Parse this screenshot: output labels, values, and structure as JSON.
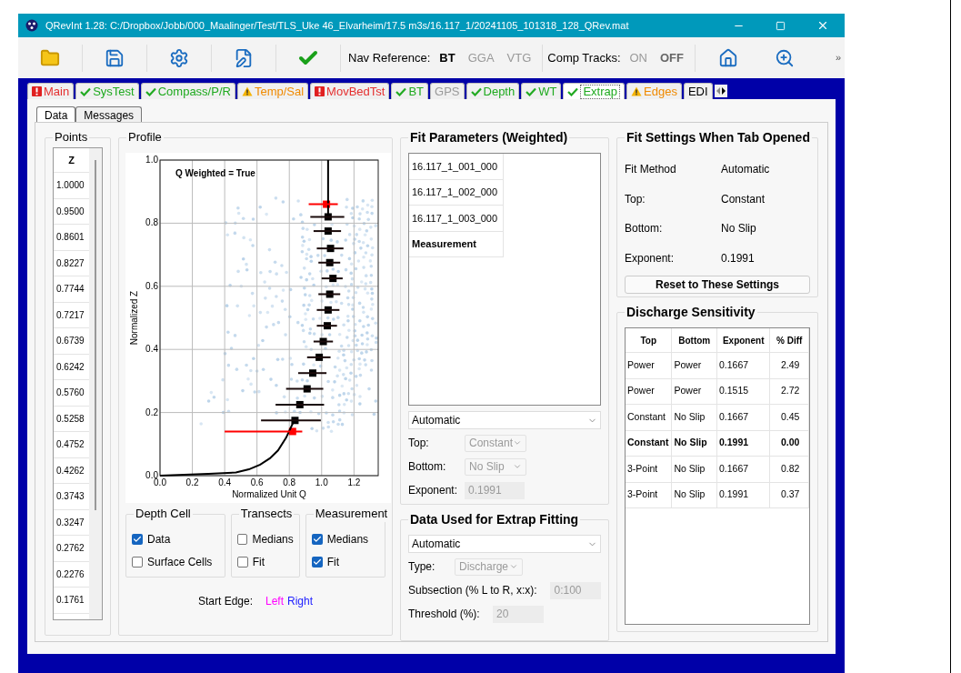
{
  "window": {
    "title": "QRevInt 1.28: C:/Dropbox/Jobb/000_Maalinger/Test/TLS_Uke 46_Elvarheim/17.5 m3s/16.117_1/20241105_101318_128_QRev.mat"
  },
  "toolbar": {
    "buttons": [
      {
        "kind": "open"
      },
      {
        "kind": "save"
      },
      {
        "kind": "settings"
      },
      {
        "kind": "edit"
      },
      {
        "kind": "check"
      }
    ],
    "nav_reference": {
      "label": "Nav Reference:",
      "options": [
        {
          "label": "BT",
          "selected": true
        },
        {
          "label": "GGA",
          "selected": false
        },
        {
          "label": "VTG",
          "selected": false
        }
      ]
    },
    "comp_tracks": {
      "label": "Comp Tracks:",
      "options": [
        {
          "label": "ON",
          "selected": false
        },
        {
          "label": "OFF",
          "selected": true
        }
      ]
    },
    "right_buttons": [
      {
        "kind": "home"
      },
      {
        "kind": "zoom"
      }
    ],
    "overflow": "»"
  },
  "tabs": [
    {
      "label": "Main",
      "kind": "error",
      "selected": false
    },
    {
      "label": "SysTest",
      "kind": "ok",
      "selected": false
    },
    {
      "label": "Compass/P/R",
      "kind": "ok",
      "selected": false
    },
    {
      "label": "Temp/Sal",
      "kind": "warning",
      "selected": false
    },
    {
      "label": "MovBedTst",
      "kind": "error",
      "selected": false
    },
    {
      "label": "BT",
      "kind": "ok",
      "selected": false
    },
    {
      "label": "GPS",
      "kind": "inactive",
      "selected": false
    },
    {
      "label": "Depth",
      "kind": "ok",
      "selected": false
    },
    {
      "label": "WT",
      "kind": "ok",
      "selected": false
    },
    {
      "label": "Extrap",
      "kind": "ok",
      "selected": true
    },
    {
      "label": "Edges",
      "kind": "warning",
      "selected": false
    },
    {
      "label": "EDI",
      "kind": "plain",
      "selected": false
    }
  ],
  "subtabs": [
    {
      "label": "Data",
      "selected": true
    },
    {
      "label": "Messages",
      "selected": false
    }
  ],
  "points": {
    "title": "Points",
    "column": "Z",
    "rows": [
      "1.0000",
      "0.9500",
      "0.8601",
      "0.8227",
      "0.7744",
      "0.7217",
      "0.6739",
      "0.6242",
      "0.5760",
      "0.5258",
      "0.4752",
      "0.4262",
      "0.3743",
      "0.3247",
      "0.2762",
      "0.2276",
      "0.1761"
    ]
  },
  "profile": {
    "title": "Profile",
    "chart_data": {
      "type": "scatter",
      "title": "Q Weighted = True",
      "xlabel": "Normalized Unit Q",
      "ylabel": "Normalized Z",
      "xlim": [
        0,
        1.35
      ],
      "ylim": [
        0,
        1
      ],
      "xticks": [
        {
          "value": 0,
          "label": "0.0"
        },
        {
          "value": 0.2,
          "label": "0.2"
        },
        {
          "value": 0.4,
          "label": "0.4"
        },
        {
          "value": 0.6,
          "label": "0.6"
        },
        {
          "value": 0.8,
          "label": "0.8"
        },
        {
          "value": 1,
          "label": "1.0"
        },
        {
          "value": 1.2,
          "label": "1.2"
        }
      ],
      "yticks": [
        {
          "value": 0,
          "label": "0.0"
        },
        {
          "value": 0.2,
          "label": "0.2"
        },
        {
          "value": 0.4,
          "label": "0.4"
        },
        {
          "value": 0.6,
          "label": "0.6"
        },
        {
          "value": 0.8,
          "label": "0.8"
        },
        {
          "value": 1,
          "label": "1.0"
        }
      ],
      "grid": true,
      "series": [
        {
          "color": "#000000",
          "type": "scatter",
          "x": [
            1.04,
            1.04,
            1.055,
            1.05,
            1.07,
            1.05,
            1.04,
            1.035,
            1.01,
            0.985,
            0.945,
            0.91,
            0.865,
            0.835
          ],
          "values": [
            0.82,
            0.775,
            0.72,
            0.675,
            0.625,
            0.575,
            0.525,
            0.475,
            0.425,
            0.375,
            0.325,
            0.275,
            0.225,
            0.175
          ]
        },
        {
          "color": "#ff0000",
          "type": "scatter",
          "x": [
            1.03,
            0.82
          ],
          "values": [
            0.86,
            0.14
          ]
        },
        {
          "color": "#000000",
          "type": "line",
          "x": [
            0,
            0.3,
            0.47,
            0.55,
            0.62,
            0.68,
            0.73,
            0.78,
            0.83,
            null,
            1.04,
            1.04
          ],
          "values": [
            0,
            0.006,
            0.01,
            0.02,
            0.035,
            0.055,
            0.08,
            0.12,
            0.175,
            null,
            0.82,
            1.0
          ]
        },
        {
          "color": "#1a0a0a",
          "type": "line",
          "x": [
            0.93,
            1.14
          ],
          "values": [
            0.82,
            0.82
          ]
        },
        {
          "color": "#1a0a0a",
          "type": "line",
          "x": [
            0.95,
            1.12
          ],
          "values": [
            0.775,
            0.775
          ]
        },
        {
          "color": "#1a0a0a",
          "type": "line",
          "x": [
            0.97,
            1.135
          ],
          "values": [
            0.72,
            0.72
          ]
        },
        {
          "color": "#1a0a0a",
          "type": "line",
          "x": [
            0.98,
            1.115
          ],
          "values": [
            0.675,
            0.675
          ]
        },
        {
          "color": "#1a0a0a",
          "type": "line",
          "x": [
            1.0,
            1.13
          ],
          "values": [
            0.625,
            0.625
          ]
        },
        {
          "color": "#1a0a0a",
          "type": "line",
          "x": [
            0.98,
            1.115
          ],
          "values": [
            0.575,
            0.575
          ]
        },
        {
          "color": "#1a0a0a",
          "type": "line",
          "x": [
            0.97,
            1.11
          ],
          "values": [
            0.525,
            0.525
          ]
        },
        {
          "color": "#1a0a0a",
          "type": "line",
          "x": [
            0.97,
            1.095
          ],
          "values": [
            0.475,
            0.475
          ]
        },
        {
          "color": "#1a0a0a",
          "type": "line",
          "x": [
            0.95,
            1.07
          ],
          "values": [
            0.425,
            0.425
          ]
        },
        {
          "color": "#1a0a0a",
          "type": "line",
          "x": [
            0.91,
            1.055
          ],
          "values": [
            0.375,
            0.375
          ]
        },
        {
          "color": "#1a0a0a",
          "type": "line",
          "x": [
            0.855,
            1.03
          ],
          "values": [
            0.325,
            0.325
          ]
        },
        {
          "color": "#1a0a0a",
          "type": "line",
          "x": [
            0.78,
            1.01
          ],
          "values": [
            0.275,
            0.275
          ]
        },
        {
          "color": "#1a0a0a",
          "type": "line",
          "x": [
            0.715,
            1.015
          ],
          "values": [
            0.225,
            0.225
          ]
        },
        {
          "color": "#1a0a0a",
          "type": "line",
          "x": [
            0.625,
            0.995
          ],
          "values": [
            0.175,
            0.175
          ]
        },
        {
          "color": "#ff0000",
          "type": "line",
          "x": [
            0.92,
            1.1
          ],
          "values": [
            0.86,
            0.86
          ]
        },
        {
          "color": "#ff0000",
          "type": "line",
          "x": [
            0.4,
            0.88
          ],
          "values": [
            0.14,
            0.14
          ]
        }
      ]
    }
  },
  "depth_cell": {
    "title": "Depth Cell",
    "options": [
      {
        "label": "Data",
        "checked": true
      },
      {
        "label": "Surface Cells",
        "checked": false
      }
    ]
  },
  "transects": {
    "title": "Transects",
    "options": [
      {
        "label": "Medians",
        "checked": false
      },
      {
        "label": "Fit",
        "checked": false
      }
    ]
  },
  "measurement": {
    "title": "Measurement",
    "options": [
      {
        "label": "Medians",
        "checked": true
      },
      {
        "label": "Fit",
        "checked": true
      }
    ]
  },
  "start_edge": {
    "label": "Start Edge:",
    "options": [
      {
        "label": "Left",
        "color": "#ff00ff"
      },
      {
        "label": "Right",
        "color": "#2222ff"
      }
    ]
  },
  "fit_parameters": {
    "title": "Fit Parameters (Weighted)",
    "items": [
      {
        "label": "16.117_1_001_000",
        "kind": "transect"
      },
      {
        "label": "16.117_1_002_000",
        "kind": "transect"
      },
      {
        "label": "16.117_1_003_000",
        "kind": "transect"
      },
      {
        "label": "Measurement",
        "kind": "total"
      }
    ],
    "method": "Automatic",
    "fields": [
      {
        "label": "Top:",
        "value": "Constant",
        "kind": "select",
        "disabled": true
      },
      {
        "label": "Bottom:",
        "value": "No Slip",
        "kind": "select",
        "disabled": true
      },
      {
        "label": "Exponent:",
        "value": "0.1991",
        "kind": "input",
        "disabled": true
      }
    ]
  },
  "data_used": {
    "title": "Data Used for Extrap Fitting",
    "method": "Automatic",
    "fields": [
      {
        "label": "Type:",
        "value": "Discharge",
        "kind": "select",
        "disabled": true
      },
      {
        "label": "Subsection (% L to R, x:x):",
        "value": "0:100",
        "kind": "input",
        "disabled": true
      },
      {
        "label": "Threshold (%):",
        "value": "20",
        "kind": "input",
        "disabled": true
      }
    ]
  },
  "fit_settings": {
    "title": "Fit Settings When Tab Opened",
    "rows": [
      {
        "label": "Fit Method",
        "value": "Automatic"
      },
      {
        "label": "Top:",
        "value": "Constant"
      },
      {
        "label": "Bottom:",
        "value": "No Slip"
      },
      {
        "label": "Exponent:",
        "value": "0.1991"
      }
    ],
    "button": "Reset to These Settings"
  },
  "sensitivity": {
    "title": "Discharge Sensitivity",
    "columns": [
      "Top",
      "Bottom",
      "Exponent",
      "% Diff"
    ],
    "rows": [
      {
        "cells": [
          "Power",
          "Power",
          "0.1667",
          "2.49"
        ],
        "selected": false
      },
      {
        "cells": [
          "Power",
          "Power",
          "0.1515",
          "2.72"
        ],
        "selected": false
      },
      {
        "cells": [
          "Constant",
          "No Slip",
          "0.1667",
          "0.45"
        ],
        "selected": false
      },
      {
        "cells": [
          "Constant",
          "No Slip",
          "0.1991",
          "0.00"
        ],
        "selected": true
      },
      {
        "cells": [
          "3-Point",
          "No Slip",
          "0.1667",
          "0.82"
        ],
        "selected": false
      },
      {
        "cells": [
          "3-Point",
          "No Slip",
          "0.1991",
          "0.37"
        ],
        "selected": false
      }
    ]
  }
}
